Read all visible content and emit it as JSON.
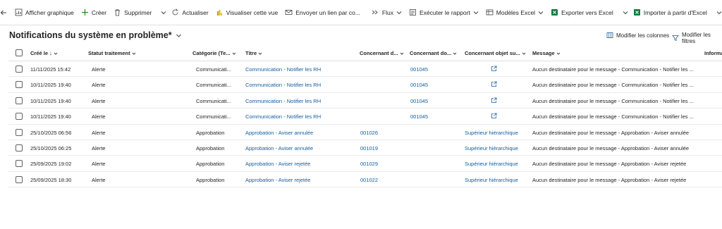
{
  "toolbar": {
    "afficher_graphique": "Afficher graphique",
    "creer": "Créer",
    "supprimer": "Supprimer",
    "actualiser": "Actualiser",
    "visualiser_vue": "Visualiser cette vue",
    "envoyer_lien": "Envoyer un lien par co...",
    "flux": "Flux",
    "executer_rapport": "Exécuter le rapport",
    "modeles_excel": "Modèles Excel",
    "exporter_excel": "Exporter vers Excel",
    "importer_excel": "Importer à partir d'Excel"
  },
  "view": {
    "title": "Notifications du système en problème*",
    "modifier_colonnes": "Modifier les colonnes",
    "modifier_filtres": "Modifier les filtres"
  },
  "columns": {
    "cree_le": "Créé le ↓",
    "statut": "Statut traitement",
    "categorie": "Catégorie (Te...",
    "titre": "Titre",
    "concernant_d": "Concernant d...",
    "concernant_do": "Concernant do...",
    "concernant_objet": "Concernant objet su...",
    "message": "Message",
    "informa": "Informa"
  },
  "rows": [
    {
      "date": "11/11/2025 15:42",
      "statut": "Alerte",
      "categorie": "Communicati...",
      "titre": "Communication - Notifier les RH",
      "concernant_d": "",
      "concernant_do": "001045",
      "objet_link": false,
      "objet": "",
      "message": "Aucun destinataire pour le message - Communication - Notifier les ..."
    },
    {
      "date": "10/11/2025 19:40",
      "statut": "Alerte",
      "categorie": "Communicati...",
      "titre": "Communication - Notifier les RH",
      "concernant_d": "",
      "concernant_do": "001045",
      "objet_link": false,
      "objet": "",
      "message": "Aucun destinataire pour le message - Communication - Notifier les ..."
    },
    {
      "date": "10/11/2025 19:40",
      "statut": "Alerte",
      "categorie": "Communicati...",
      "titre": "Communication - Notifier les RH",
      "concernant_d": "",
      "concernant_do": "001045",
      "objet_link": false,
      "objet": "",
      "message": "Aucun destinataire pour le message - Communication - Notifier les ..."
    },
    {
      "date": "10/11/2025 19:40",
      "statut": "Alerte",
      "categorie": "Communicati...",
      "titre": "Communication - Notifier les RH",
      "concernant_d": "",
      "concernant_do": "001045",
      "objet_link": false,
      "objet": "",
      "message": "Aucun destinataire pour le message - Communication - Notifier les ..."
    },
    {
      "date": "25/10/2025 06:56",
      "statut": "Alerte",
      "categorie": "Approbation",
      "titre": "Approbation - Aviser annulée",
      "concernant_d": "001026",
      "concernant_do": "",
      "objet_link": true,
      "objet": "Supérieur hiérarchique",
      "message": "Aucun destinataire pour le message - Approbation - Aviser annulée"
    },
    {
      "date": "25/10/2025 06:25",
      "statut": "Alerte",
      "categorie": "Approbation",
      "titre": "Approbation - Aviser annulée",
      "concernant_d": "001019",
      "concernant_do": "",
      "objet_link": true,
      "objet": "Supérieur hiérarchique",
      "message": "Aucun destinataire pour le message - Approbation - Aviser annulée"
    },
    {
      "date": "25/09/2025 19:02",
      "statut": "Alerte",
      "categorie": "Approbation",
      "titre": "Approbation - Aviser rejetée",
      "concernant_d": "001029",
      "concernant_do": "",
      "objet_link": true,
      "objet": "Supérieur hiérarchique",
      "message": "Aucun destinataire pour le message - Approbation - Aviser rejetée"
    },
    {
      "date": "25/09/2025 18:30",
      "statut": "Alerte",
      "categorie": "Approbation",
      "titre": "Approbation - Aviser rejetée",
      "concernant_d": "001022",
      "concernant_do": "",
      "objet_link": true,
      "objet": "Supérieur hiérarchique",
      "message": "Aucun destinataire pour le message - Approbation - Aviser rejetée"
    }
  ]
}
